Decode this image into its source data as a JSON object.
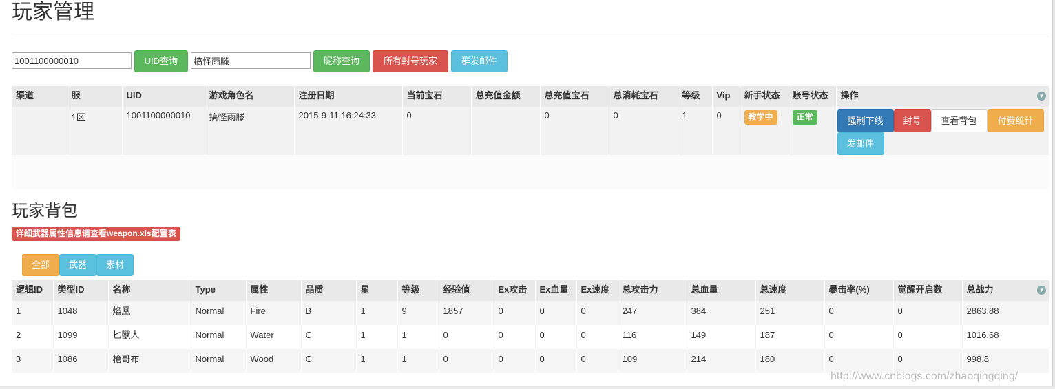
{
  "page_title": "玩家管理",
  "search": {
    "uid_value": "1001100000010",
    "uid_button": "UID查询",
    "nickname_value": "搞怪雨滕",
    "nickname_button": "昵称查询",
    "banned_button": "所有封号玩家",
    "mass_mail_button": "群发邮件"
  },
  "player_table": {
    "headers": [
      "渠道",
      "服",
      "UID",
      "游戏角色名",
      "注册日期",
      "当前宝石",
      "总充值金额",
      "总充值宝石",
      "总消耗宝石",
      "等级",
      "Vip",
      "新手状态",
      "账号状态",
      "操作"
    ],
    "row": {
      "channel": "",
      "server": "1区",
      "uid": "1001100000010",
      "role_name": "搞怪雨滕",
      "register_date": "2015-9-11 16:24:33",
      "current_gems": "0",
      "total_recharge_amount": "",
      "total_recharge_gems": "0",
      "total_consumed_gems": "0",
      "level": "1",
      "vip": "0",
      "newbie_status": "教学中",
      "account_status": "正常"
    },
    "actions": {
      "force_offline": "强制下线",
      "ban": "封号",
      "view_bag": "查看背包",
      "payment_stats": "付费统计",
      "send_mail": "发邮件"
    }
  },
  "bag_section": {
    "title": "玩家背包",
    "info_label": "详细武器属性信息请查看weapon.xls配置表",
    "filters": [
      "全部",
      "武器",
      "素材"
    ],
    "headers": [
      "逻辑ID",
      "类型ID",
      "名称",
      "Type",
      "属性",
      "品质",
      "星",
      "等级",
      "经验值",
      "Ex攻击",
      "Ex血量",
      "Ex速度",
      "总攻击力",
      "总血量",
      "总速度",
      "暴击率(%)",
      "觉醒开启数",
      "总战力"
    ],
    "rows": [
      [
        "1",
        "1048",
        "焰凰",
        "Normal",
        "Fire",
        "B",
        "1",
        "9",
        "1857",
        "0",
        "0",
        "0",
        "247",
        "384",
        "251",
        "0",
        "0",
        "2863.88"
      ],
      [
        "2",
        "1099",
        "匕獸人",
        "Normal",
        "Water",
        "C",
        "1",
        "1",
        "0",
        "0",
        "0",
        "0",
        "116",
        "149",
        "187",
        "0",
        "0",
        "1016.68"
      ],
      [
        "3",
        "1086",
        "槍哥布",
        "Normal",
        "Wood",
        "C",
        "1",
        "1",
        "0",
        "0",
        "0",
        "0",
        "109",
        "214",
        "180",
        "0",
        "0",
        "998.8"
      ]
    ]
  },
  "watermark": "http://www.cnblogs.com/zhaoqingqing/",
  "colors": {
    "success": "#5cb85c",
    "danger": "#d9534f",
    "info": "#5bc0de",
    "primary": "#337ab7",
    "warning": "#f0ad4e"
  }
}
